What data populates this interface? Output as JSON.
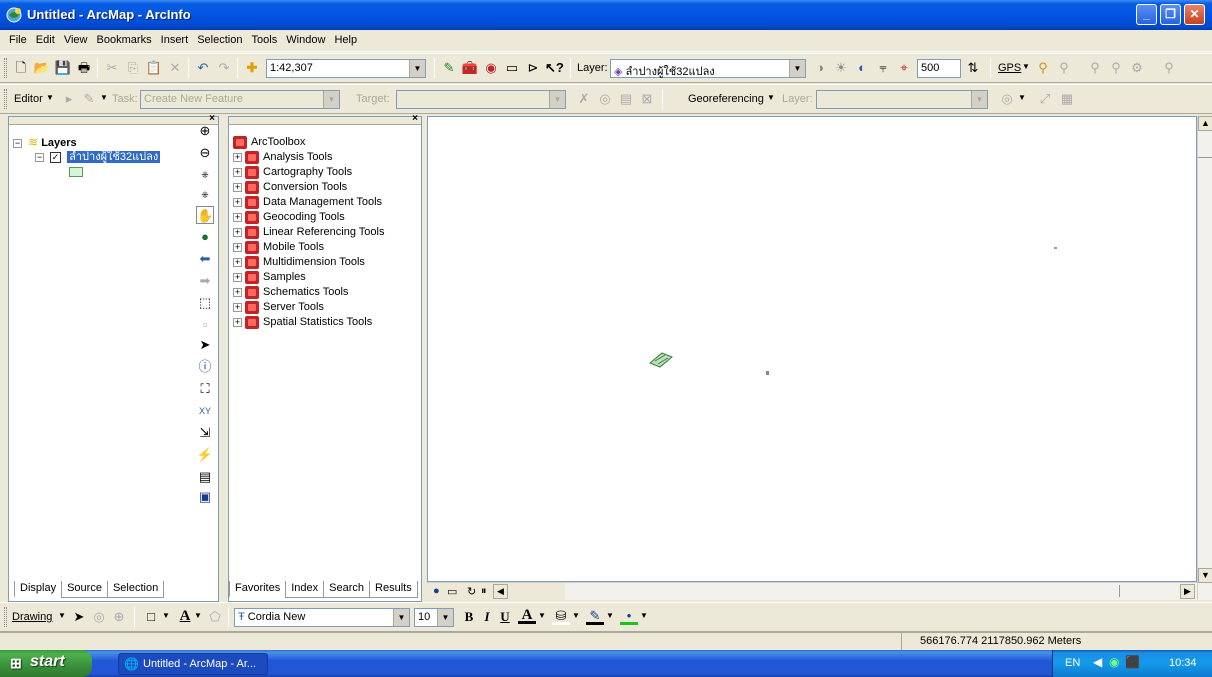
{
  "window": {
    "title": "Untitled - ArcMap - ArcInfo",
    "minimize": "_",
    "maximize": "❐",
    "close": "✕"
  },
  "menu": [
    "File",
    "Edit",
    "View",
    "Bookmarks",
    "Insert",
    "Selection",
    "Tools",
    "Window",
    "Help"
  ],
  "standard_toolbar": {
    "scale": "1:42,307",
    "layer_label": "Layer:",
    "layer_value": "ลำปางผู้ใช้32แปลง",
    "distance_value": "500",
    "gps_label": "GPS"
  },
  "editor_toolbar": {
    "editor_label": "Editor",
    "task_label": "Task:",
    "task_value": "Create New Feature",
    "target_label": "Target:",
    "georef_label": "Georeferencing",
    "georef_layer_label": "Layer:"
  },
  "toc": {
    "root_label": "Layers",
    "layer_name": "ลำปางผู้ใช้32แปลง",
    "tabs": [
      "Display",
      "Source",
      "Selection"
    ]
  },
  "toolbox": {
    "root_label": "ArcToolbox",
    "items": [
      "Analysis Tools",
      "Cartography Tools",
      "Conversion Tools",
      "Data Management Tools",
      "Geocoding Tools",
      "Linear Referencing Tools",
      "Mobile Tools",
      "Multidimension Tools",
      "Samples",
      "Schematics Tools",
      "Server Tools",
      "Spatial Statistics Tools"
    ],
    "tabs": [
      "Favorites",
      "Index",
      "Search",
      "Results"
    ]
  },
  "drawing_toolbar": {
    "drawing_label": "Drawing",
    "font_name": "Cordia New",
    "font_size": "10",
    "bold": "B",
    "italic": "I",
    "underline": "U"
  },
  "status": {
    "coordinates": "566176.774  2117850.962 Meters"
  },
  "taskbar": {
    "start_label": "start",
    "task_label": "Untitled - ArcMap - Ar...",
    "lang": "EN",
    "clock": "10:34"
  },
  "colors": {
    "titlebar": "#0054e3",
    "taskbar": "#2157d7",
    "start": "#3b8f3b",
    "panel_bg": "#ece9d8"
  }
}
